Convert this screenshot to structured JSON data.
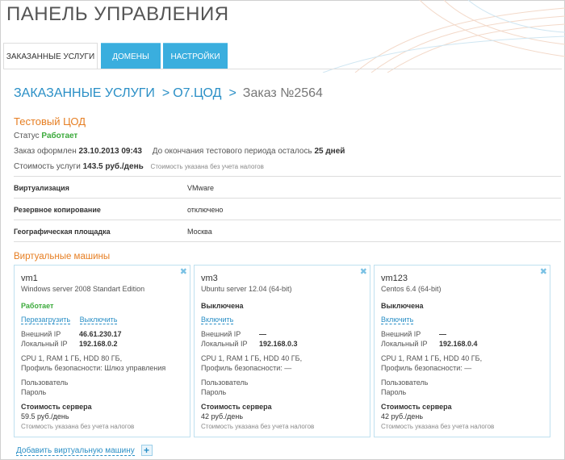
{
  "header": {
    "title": "ПАНЕЛЬ УПРАВЛЕНИЯ"
  },
  "tabs": [
    {
      "label": "ЗАКАЗАННЫЕ УСЛУГИ"
    },
    {
      "label": "ДОМЕНЫ"
    },
    {
      "label": "НАСТРОЙКИ"
    }
  ],
  "breadcrumb": {
    "root": "ЗАКАЗАННЫЕ УСЛУГИ",
    "sep1": ">",
    "section": "О7.ЦОД",
    "sep2": ">",
    "current": "Заказ №2564"
  },
  "service": {
    "title": "Тестовый ЦОД",
    "status_label": "Статус",
    "status_value": "Работает",
    "order_label": "Заказ оформлен",
    "order_date": "23.10.2013 09:43",
    "trial_label": "До окончания тестового периода осталось",
    "trial_value": "25 дней",
    "cost_label": "Стоимость услуги",
    "cost_value": "143.5 руб./день",
    "cost_note": "Стоимость указана без учета налогов"
  },
  "properties": [
    {
      "name": "Виртуализация",
      "value": "VMware"
    },
    {
      "name": "Резервное копирование",
      "value": "отключено"
    },
    {
      "name": "Географическая площадка",
      "value": "Москва"
    }
  ],
  "vms_section": {
    "title": "Виртуальные машины",
    "add_label": "Добавить виртуальную машину",
    "add_icon": "+"
  },
  "vms": [
    {
      "name": "vm1",
      "os": "Windows server 2008 Standart Edition",
      "state": "Работает",
      "actions": [
        "Перезагрузить",
        "Выключить"
      ],
      "ext_ip_label": "Внешний IP",
      "ext_ip": "46.61.230.17",
      "loc_ip_label": "Локальный IP",
      "loc_ip": "192.168.0.2",
      "spec": "CPU 1, RAM 1 ГБ, HDD 80 ГБ,",
      "security": "Профиль безопасности: Шлюз управления",
      "user_label": "Пользователь",
      "password_label": "Пароль",
      "price_label": "Стоимость сервера",
      "price": "59.5 руб./день",
      "price_note": "Стоимость указана без учета налогов"
    },
    {
      "name": "vm3",
      "os": "Ubuntu server 12.04 (64-bit)",
      "state": "Выключена",
      "actions": [
        "Включить"
      ],
      "ext_ip_label": "Внешний IP",
      "ext_ip": "—",
      "loc_ip_label": "Локальный IP",
      "loc_ip": "192.168.0.3",
      "spec": "CPU 1, RAM 1 ГБ, HDD 40 ГБ,",
      "security": "Профиль безопасности: —",
      "user_label": "Пользователь",
      "password_label": "Пароль",
      "price_label": "Стоимость сервера",
      "price": "42 руб./день",
      "price_note": "Стоимость указана без учета налогов"
    },
    {
      "name": "vm123",
      "os": "Centos 6.4 (64-bit)",
      "state": "Выключена",
      "actions": [
        "Включить"
      ],
      "ext_ip_label": "Внешний IP",
      "ext_ip": "—",
      "loc_ip_label": "Локальный IP",
      "loc_ip": "192.168.0.4",
      "spec": "CPU 1, RAM 1 ГБ, HDD 40 ГБ,",
      "security": "Профиль безопасности: —",
      "user_label": "Пользователь",
      "password_label": "Пароль",
      "price_label": "Стоимость сервера",
      "price": "42 руб./день",
      "price_note": "Стоимость указана без учета налогов"
    }
  ],
  "colors": {
    "accent": "#3aaede",
    "link": "#2a8fc6",
    "orange": "#e67e22",
    "ok": "#3caa3c"
  },
  "icons": {
    "close": "close-icon",
    "add": "plus-icon"
  }
}
